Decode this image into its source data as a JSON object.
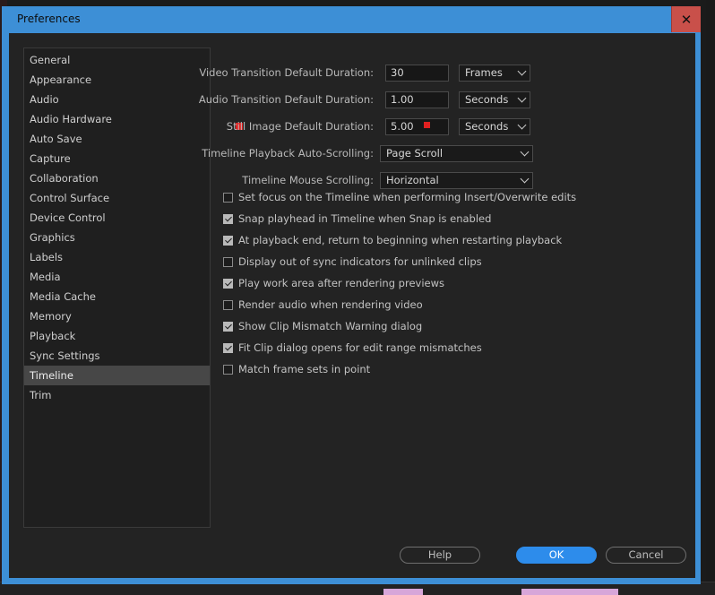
{
  "window": {
    "title": "Preferences",
    "close_glyph": "✕"
  },
  "sidebar": {
    "items": [
      {
        "label": "General"
      },
      {
        "label": "Appearance"
      },
      {
        "label": "Audio"
      },
      {
        "label": "Audio Hardware"
      },
      {
        "label": "Auto Save"
      },
      {
        "label": "Capture"
      },
      {
        "label": "Collaboration"
      },
      {
        "label": "Control Surface"
      },
      {
        "label": "Device Control"
      },
      {
        "label": "Graphics"
      },
      {
        "label": "Labels"
      },
      {
        "label": "Media"
      },
      {
        "label": "Media Cache"
      },
      {
        "label": "Memory"
      },
      {
        "label": "Playback"
      },
      {
        "label": "Sync Settings"
      },
      {
        "label": "Timeline",
        "active": true
      },
      {
        "label": "Trim"
      }
    ]
  },
  "settings": {
    "video_transition": {
      "label": "Video Transition Default Duration:",
      "value": "30",
      "unit": "Frames"
    },
    "audio_transition": {
      "label": "Audio Transition Default Duration:",
      "value": "1.00",
      "unit": "Seconds"
    },
    "still_image": {
      "label": "Still Image Default Duration:",
      "value": "5.00",
      "unit": "Seconds"
    },
    "auto_scroll": {
      "label": "Timeline Playback Auto-Scrolling:",
      "value": "Page Scroll"
    },
    "mouse_scroll": {
      "label": "Timeline Mouse Scrolling:",
      "value": "Horizontal"
    }
  },
  "checkboxes": [
    {
      "label": "Set focus on the Timeline when performing Insert/Overwrite edits",
      "checked": false
    },
    {
      "label": "Snap playhead in Timeline when Snap is enabled",
      "checked": true
    },
    {
      "label": "At playback end, return to beginning when restarting playback",
      "checked": true
    },
    {
      "label": "Display out of sync indicators for unlinked clips",
      "checked": false
    },
    {
      "label": "Play work area after rendering previews",
      "checked": true
    },
    {
      "label": "Render audio when rendering video",
      "checked": false
    },
    {
      "label": "Show Clip Mismatch Warning dialog",
      "checked": true
    },
    {
      "label": "Fit Clip dialog opens for edit range mismatches",
      "checked": true
    },
    {
      "label": "Match frame sets in point",
      "checked": false
    }
  ],
  "buttons": {
    "help": "Help",
    "ok": "OK",
    "cancel": "Cancel"
  },
  "colors": {
    "accent": "#2d8ceb",
    "title_bar": "#3d8fd6",
    "close": "#c9504a",
    "indicator": "#e02020"
  }
}
